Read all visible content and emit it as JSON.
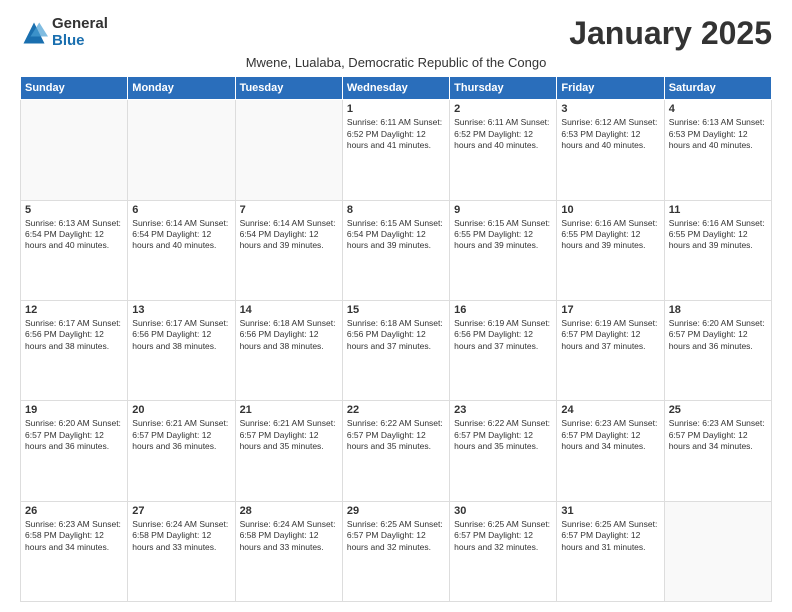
{
  "logo": {
    "general": "General",
    "blue": "Blue"
  },
  "title": "January 2025",
  "subtitle": "Mwene, Lualaba, Democratic Republic of the Congo",
  "days_header": [
    "Sunday",
    "Monday",
    "Tuesday",
    "Wednesday",
    "Thursday",
    "Friday",
    "Saturday"
  ],
  "weeks": [
    [
      {
        "day": "",
        "info": ""
      },
      {
        "day": "",
        "info": ""
      },
      {
        "day": "",
        "info": ""
      },
      {
        "day": "1",
        "info": "Sunrise: 6:11 AM\nSunset: 6:52 PM\nDaylight: 12 hours\nand 41 minutes."
      },
      {
        "day": "2",
        "info": "Sunrise: 6:11 AM\nSunset: 6:52 PM\nDaylight: 12 hours\nand 40 minutes."
      },
      {
        "day": "3",
        "info": "Sunrise: 6:12 AM\nSunset: 6:53 PM\nDaylight: 12 hours\nand 40 minutes."
      },
      {
        "day": "4",
        "info": "Sunrise: 6:13 AM\nSunset: 6:53 PM\nDaylight: 12 hours\nand 40 minutes."
      }
    ],
    [
      {
        "day": "5",
        "info": "Sunrise: 6:13 AM\nSunset: 6:54 PM\nDaylight: 12 hours\nand 40 minutes."
      },
      {
        "day": "6",
        "info": "Sunrise: 6:14 AM\nSunset: 6:54 PM\nDaylight: 12 hours\nand 40 minutes."
      },
      {
        "day": "7",
        "info": "Sunrise: 6:14 AM\nSunset: 6:54 PM\nDaylight: 12 hours\nand 39 minutes."
      },
      {
        "day": "8",
        "info": "Sunrise: 6:15 AM\nSunset: 6:54 PM\nDaylight: 12 hours\nand 39 minutes."
      },
      {
        "day": "9",
        "info": "Sunrise: 6:15 AM\nSunset: 6:55 PM\nDaylight: 12 hours\nand 39 minutes."
      },
      {
        "day": "10",
        "info": "Sunrise: 6:16 AM\nSunset: 6:55 PM\nDaylight: 12 hours\nand 39 minutes."
      },
      {
        "day": "11",
        "info": "Sunrise: 6:16 AM\nSunset: 6:55 PM\nDaylight: 12 hours\nand 39 minutes."
      }
    ],
    [
      {
        "day": "12",
        "info": "Sunrise: 6:17 AM\nSunset: 6:56 PM\nDaylight: 12 hours\nand 38 minutes."
      },
      {
        "day": "13",
        "info": "Sunrise: 6:17 AM\nSunset: 6:56 PM\nDaylight: 12 hours\nand 38 minutes."
      },
      {
        "day": "14",
        "info": "Sunrise: 6:18 AM\nSunset: 6:56 PM\nDaylight: 12 hours\nand 38 minutes."
      },
      {
        "day": "15",
        "info": "Sunrise: 6:18 AM\nSunset: 6:56 PM\nDaylight: 12 hours\nand 37 minutes."
      },
      {
        "day": "16",
        "info": "Sunrise: 6:19 AM\nSunset: 6:56 PM\nDaylight: 12 hours\nand 37 minutes."
      },
      {
        "day": "17",
        "info": "Sunrise: 6:19 AM\nSunset: 6:57 PM\nDaylight: 12 hours\nand 37 minutes."
      },
      {
        "day": "18",
        "info": "Sunrise: 6:20 AM\nSunset: 6:57 PM\nDaylight: 12 hours\nand 36 minutes."
      }
    ],
    [
      {
        "day": "19",
        "info": "Sunrise: 6:20 AM\nSunset: 6:57 PM\nDaylight: 12 hours\nand 36 minutes."
      },
      {
        "day": "20",
        "info": "Sunrise: 6:21 AM\nSunset: 6:57 PM\nDaylight: 12 hours\nand 36 minutes."
      },
      {
        "day": "21",
        "info": "Sunrise: 6:21 AM\nSunset: 6:57 PM\nDaylight: 12 hours\nand 35 minutes."
      },
      {
        "day": "22",
        "info": "Sunrise: 6:22 AM\nSunset: 6:57 PM\nDaylight: 12 hours\nand 35 minutes."
      },
      {
        "day": "23",
        "info": "Sunrise: 6:22 AM\nSunset: 6:57 PM\nDaylight: 12 hours\nand 35 minutes."
      },
      {
        "day": "24",
        "info": "Sunrise: 6:23 AM\nSunset: 6:57 PM\nDaylight: 12 hours\nand 34 minutes."
      },
      {
        "day": "25",
        "info": "Sunrise: 6:23 AM\nSunset: 6:57 PM\nDaylight: 12 hours\nand 34 minutes."
      }
    ],
    [
      {
        "day": "26",
        "info": "Sunrise: 6:23 AM\nSunset: 6:58 PM\nDaylight: 12 hours\nand 34 minutes."
      },
      {
        "day": "27",
        "info": "Sunrise: 6:24 AM\nSunset: 6:58 PM\nDaylight: 12 hours\nand 33 minutes."
      },
      {
        "day": "28",
        "info": "Sunrise: 6:24 AM\nSunset: 6:58 PM\nDaylight: 12 hours\nand 33 minutes."
      },
      {
        "day": "29",
        "info": "Sunrise: 6:25 AM\nSunset: 6:57 PM\nDaylight: 12 hours\nand 32 minutes."
      },
      {
        "day": "30",
        "info": "Sunrise: 6:25 AM\nSunset: 6:57 PM\nDaylight: 12 hours\nand 32 minutes."
      },
      {
        "day": "31",
        "info": "Sunrise: 6:25 AM\nSunset: 6:57 PM\nDaylight: 12 hours\nand 31 minutes."
      },
      {
        "day": "",
        "info": ""
      }
    ]
  ]
}
